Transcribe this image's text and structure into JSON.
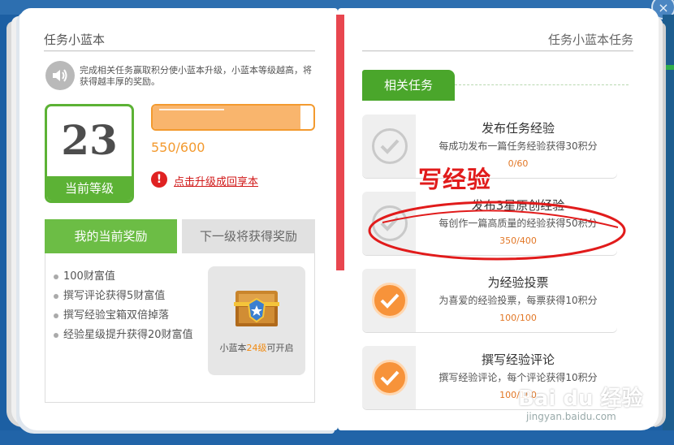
{
  "left": {
    "title": "任务小蓝本",
    "intro": "完成相关任务赢取积分使小蓝本升级，小蓝本等级越高，将获得越丰厚的奖励。",
    "level": "23",
    "level_label": "当前等级",
    "progress_text": "550/600",
    "progress_fraction": 0.917,
    "upgrade_icon_text": "!",
    "upgrade_link": "点击升级成回享本",
    "tab_current": "我的当前奖励",
    "tab_next": "下一级将获得奖励",
    "rewards": [
      "100财富值",
      "撰写评论获得5财富值",
      "撰写经验宝箱双倍掉落",
      "经验星级提升获得20财富值"
    ],
    "chest_caption_pre": "小蓝本",
    "chest_caption_level": "24级",
    "chest_caption_post": "可开启"
  },
  "right": {
    "title": "任务小蓝本任务",
    "related_tab": "相关任务",
    "tasks": [
      {
        "title": "发布任务经验",
        "desc": "每成功发布一篇任务经验获得30积分",
        "progress": "0/60",
        "state": "incomplete"
      },
      {
        "title": "发布3星原创经验",
        "desc": "每创作一篇高质量的经验获得50积分",
        "progress": "350/400",
        "state": "incomplete"
      },
      {
        "title": "为经验投票",
        "desc": "为喜爱的经验投票，每票获得10积分",
        "progress": "100/100",
        "state": "complete"
      },
      {
        "title": "撰写经验评论",
        "desc": "撰写经验评论，每个评论获得10积分",
        "progress": "100/100",
        "state": "complete"
      }
    ]
  },
  "annotation": {
    "text": "写经验",
    "color": "#e11b1b"
  },
  "watermark": {
    "brand": "Bai du 经验",
    "url": "jingyan.baidu.com"
  },
  "window": {
    "close_icon": "close-icon",
    "close_glyph": "×"
  },
  "colors": {
    "green": "#5cb235",
    "orange": "#f39a2f",
    "red": "#e02222",
    "blue_frame": "#1c5fa3"
  }
}
